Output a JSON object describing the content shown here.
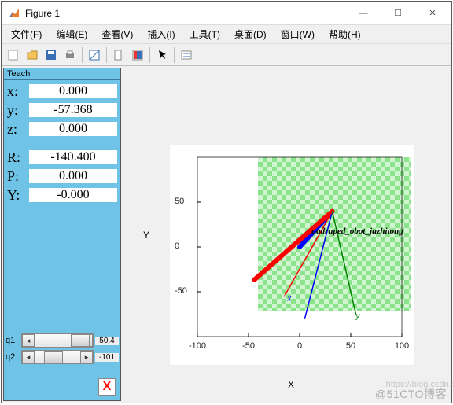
{
  "window": {
    "title": "Figure 1"
  },
  "menu": {
    "file": "文件(F)",
    "edit": "编辑(E)",
    "view": "查看(V)",
    "insert": "插入(I)",
    "tools": "工具(T)",
    "desktop": "桌面(D)",
    "window": "窗口(W)",
    "help": "帮助(H)"
  },
  "teach": {
    "title": "Teach",
    "x_label": "x:",
    "x_value": "0.000",
    "y_label": "y:",
    "y_value": "-57.368",
    "z_label": "z:",
    "z_value": "0.000",
    "R_label": "R:",
    "R_value": "-140.400",
    "P_label": "P:",
    "P_value": "0.000",
    "Y_label": "Y:",
    "Y_value": "-0.000",
    "q1_label": "q1",
    "q1_value": "50.4",
    "q2_label": "q2",
    "q2_value": "-101",
    "close": "X"
  },
  "chart_data": {
    "type": "robot-plot",
    "title": "",
    "xlabel": "X",
    "ylabel": "Y",
    "xlim": [
      -100,
      100
    ],
    "ylim": [
      -100,
      100
    ],
    "xticks": [
      -100,
      -50,
      0,
      50,
      100
    ],
    "yticks": [
      -50,
      0,
      50
    ],
    "floor_range": [
      -50,
      100
    ],
    "robot_name": "uadruped_obot_juzhitong",
    "links": [
      {
        "color": "blue",
        "from": [
          0,
          0
        ],
        "to": [
          31.9,
          39.7
        ],
        "width": 6
      },
      {
        "color": "red",
        "from": [
          31.9,
          39.7
        ],
        "to": [
          -44.2,
          -36.5
        ],
        "width": 6
      },
      {
        "color": "blue",
        "from": [
          31.9,
          39.7
        ],
        "to": [
          5,
          -80
        ],
        "width": 1.5
      },
      {
        "color": "red",
        "from": [
          31.9,
          39.7
        ],
        "to": [
          -15,
          -55
        ],
        "width": 1.5
      },
      {
        "color": "green",
        "from": [
          31.9,
          39.7
        ],
        "to": [
          55,
          -75
        ],
        "width": 1.5
      }
    ],
    "end_effector_labels": [
      {
        "text": "x",
        "at": [
          -12,
          -60
        ],
        "color": "blue"
      },
      {
        "text": "y",
        "at": [
          55,
          -80
        ],
        "color": "green"
      }
    ]
  },
  "watermark": "@51CTO博客",
  "watermark2": "https://blog.csdn.ne"
}
